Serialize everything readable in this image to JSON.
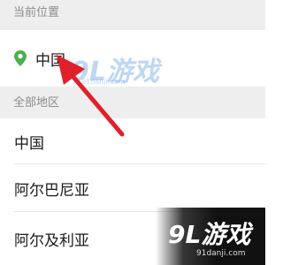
{
  "sections": {
    "current_title": "当前位置",
    "all_title": "全部地区"
  },
  "current_location": {
    "icon": "location-pin-icon",
    "icon_color": "#4caf50",
    "label": "中国"
  },
  "regions": [
    {
      "label": "中国"
    },
    {
      "label": "阿尔巴尼亚"
    },
    {
      "label": "阿尔及利亚"
    }
  ],
  "annotation": {
    "arrow_color": "#e0202a"
  },
  "watermark": {
    "logo": "9L游戏",
    "url": "91danji.com"
  }
}
